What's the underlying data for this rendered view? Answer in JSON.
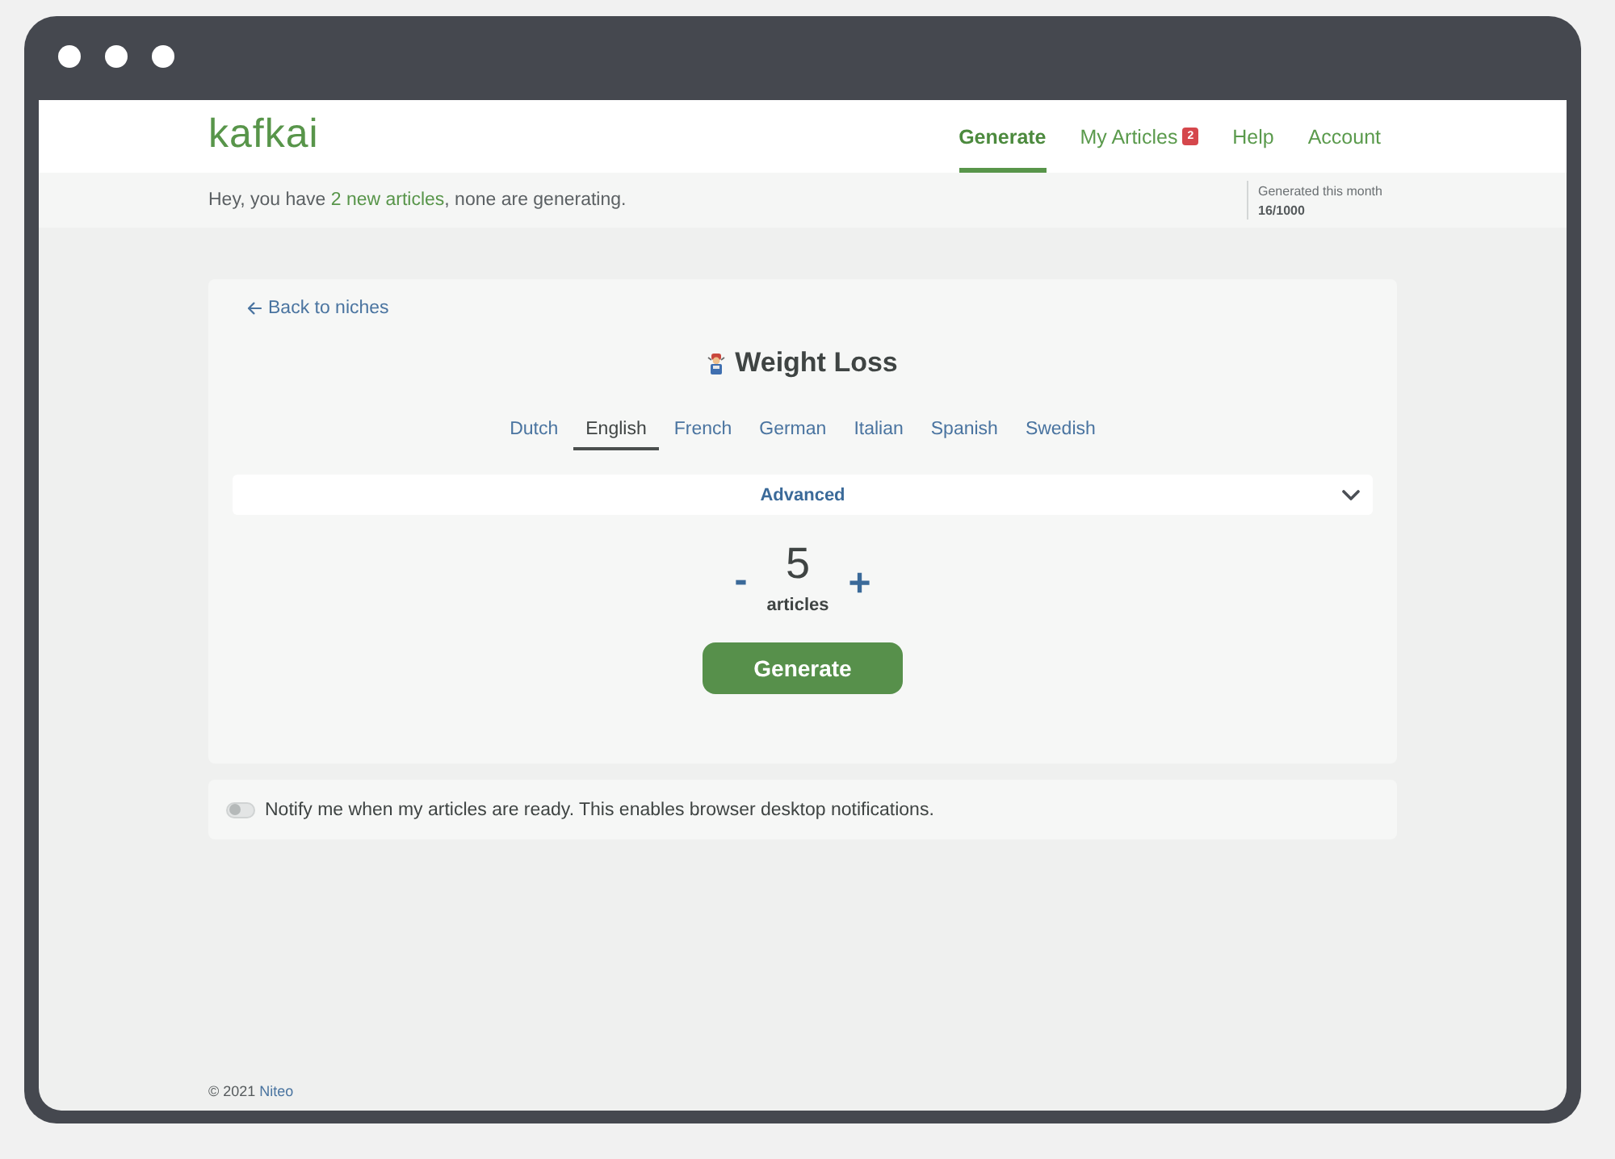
{
  "header": {
    "logo": "kafkai",
    "nav": [
      {
        "label": "Generate",
        "selected": true
      },
      {
        "label": "My Articles",
        "selected": false,
        "badge": "2"
      },
      {
        "label": "Help",
        "selected": false
      },
      {
        "label": "Account",
        "selected": false
      }
    ]
  },
  "notice_bar": {
    "message": {
      "before": "Hey, you have ",
      "link": "2 new articles",
      "after": ", none are generating."
    },
    "stat": {
      "label": "Generated this month",
      "value": "16/1000"
    }
  },
  "niche_card": {
    "back_link": "Back to niches",
    "title": "Weight Loss",
    "language_tabs": [
      {
        "label": "Dutch",
        "selected": false
      },
      {
        "label": "English",
        "selected": true
      },
      {
        "label": "French",
        "selected": false
      },
      {
        "label": "German",
        "selected": false
      },
      {
        "label": "Italian",
        "selected": false
      },
      {
        "label": "Spanish",
        "selected": false
      },
      {
        "label": "Swedish",
        "selected": false
      }
    ],
    "advanced": {
      "label": "Advanced",
      "expanded": false
    },
    "counter": {
      "decrement": "-",
      "value": "5",
      "unit": "articles",
      "increment": "+"
    },
    "submit": "Generate"
  },
  "notify": {
    "on": false,
    "text": "Notify me when my articles are ready. This enables browser desktop notifications."
  },
  "footer": {
    "before": "© 2021 ",
    "link": "Niteo"
  }
}
